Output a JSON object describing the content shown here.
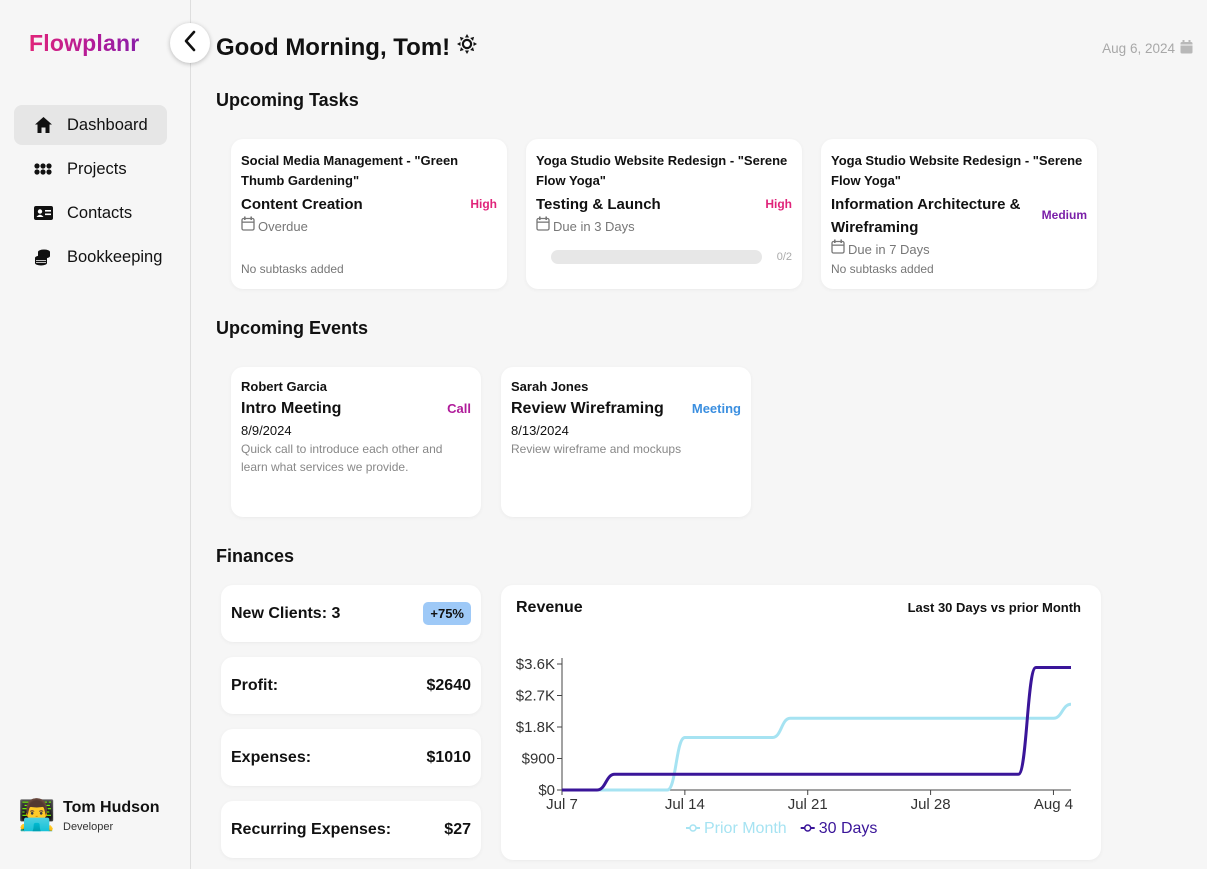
{
  "app": {
    "name": "Flowplanr"
  },
  "sidebar": {
    "items": [
      {
        "label": "Dashboard",
        "icon": "home-icon",
        "active": true
      },
      {
        "label": "Projects",
        "icon": "grid-dots-icon",
        "active": false
      },
      {
        "label": "Contacts",
        "icon": "id-card-icon",
        "active": false
      },
      {
        "label": "Bookkeeping",
        "icon": "coins-icon",
        "active": false
      }
    ],
    "user": {
      "avatar": "👨‍💻",
      "name": "Tom Hudson",
      "role": "Developer"
    }
  },
  "header": {
    "greeting": "Good Morning, Tom!",
    "date": "Aug 6, 2024"
  },
  "tasks": {
    "title": "Upcoming Tasks",
    "items": [
      {
        "project": "Social Media Management - \"Green Thumb Gardening\"",
        "title": "Content Creation",
        "priority": "High",
        "due": "Overdue",
        "subtasks": "No subtasks added"
      },
      {
        "project": "Yoga Studio Website Redesign - \"Serene Flow Yoga\"",
        "title": "Testing & Launch",
        "priority": "High",
        "due": "Due in 3 Days",
        "progress": "0/2",
        "progress_fraction": 0
      },
      {
        "project": "Yoga Studio Website Redesign - \"Serene Flow Yoga\"",
        "title": "Information Architecture & Wireframing",
        "priority": "Medium",
        "due": "Due in 7 Days",
        "subtasks": "No subtasks added"
      }
    ]
  },
  "events": {
    "title": "Upcoming Events",
    "items": [
      {
        "person": "Robert Garcia",
        "title": "Intro Meeting",
        "type": "Call",
        "type_color": "#b01b9a",
        "date": "8/9/2024",
        "description": "Quick call to introduce each other and learn what services we provide."
      },
      {
        "person": "Sarah Jones",
        "title": "Review Wireframing",
        "type": "Meeting",
        "type_color": "#3b8fe0",
        "date": "8/13/2024",
        "description": "Review wireframe and mockups"
      }
    ]
  },
  "finances": {
    "title": "Finances",
    "new_clients": {
      "label": "New Clients: 3",
      "badge": "+75%"
    },
    "profit": {
      "label": "Profit:",
      "value": "$2640"
    },
    "expenses": {
      "label": "Expenses:",
      "value": "$1010"
    },
    "recurring": {
      "label": "Recurring Expenses:",
      "value": "$27"
    }
  },
  "chart_data": {
    "type": "line",
    "title": "Revenue",
    "subtitle": "Last 30 Days vs prior Month",
    "x_ticks": [
      "Jul 7",
      "Jul 14",
      "Jul 21",
      "Jul 28",
      "Aug 4"
    ],
    "y_ticks": [
      "$0",
      "$900",
      "$1.8K",
      "$2.7K",
      "$3.6K"
    ],
    "ylim": [
      0,
      3600
    ],
    "x_domain": [
      "2024-07-07",
      "2024-08-05"
    ],
    "series": [
      {
        "name": "Prior Month",
        "color": "#a6e3f2",
        "points": [
          [
            "2024-07-07",
            0
          ],
          [
            "2024-07-13",
            0
          ],
          [
            "2024-07-14",
            1500
          ],
          [
            "2024-07-19",
            1500
          ],
          [
            "2024-07-20",
            2050
          ],
          [
            "2024-08-04",
            2050
          ],
          [
            "2024-08-05",
            2450
          ]
        ]
      },
      {
        "name": "30 Days",
        "color": "#3a1599",
        "points": [
          [
            "2024-07-07",
            0
          ],
          [
            "2024-07-09",
            0
          ],
          [
            "2024-07-10",
            450
          ],
          [
            "2024-08-02",
            450
          ],
          [
            "2024-08-03",
            3500
          ],
          [
            "2024-08-05",
            3500
          ]
        ]
      }
    ],
    "legend": "bottom-center"
  }
}
